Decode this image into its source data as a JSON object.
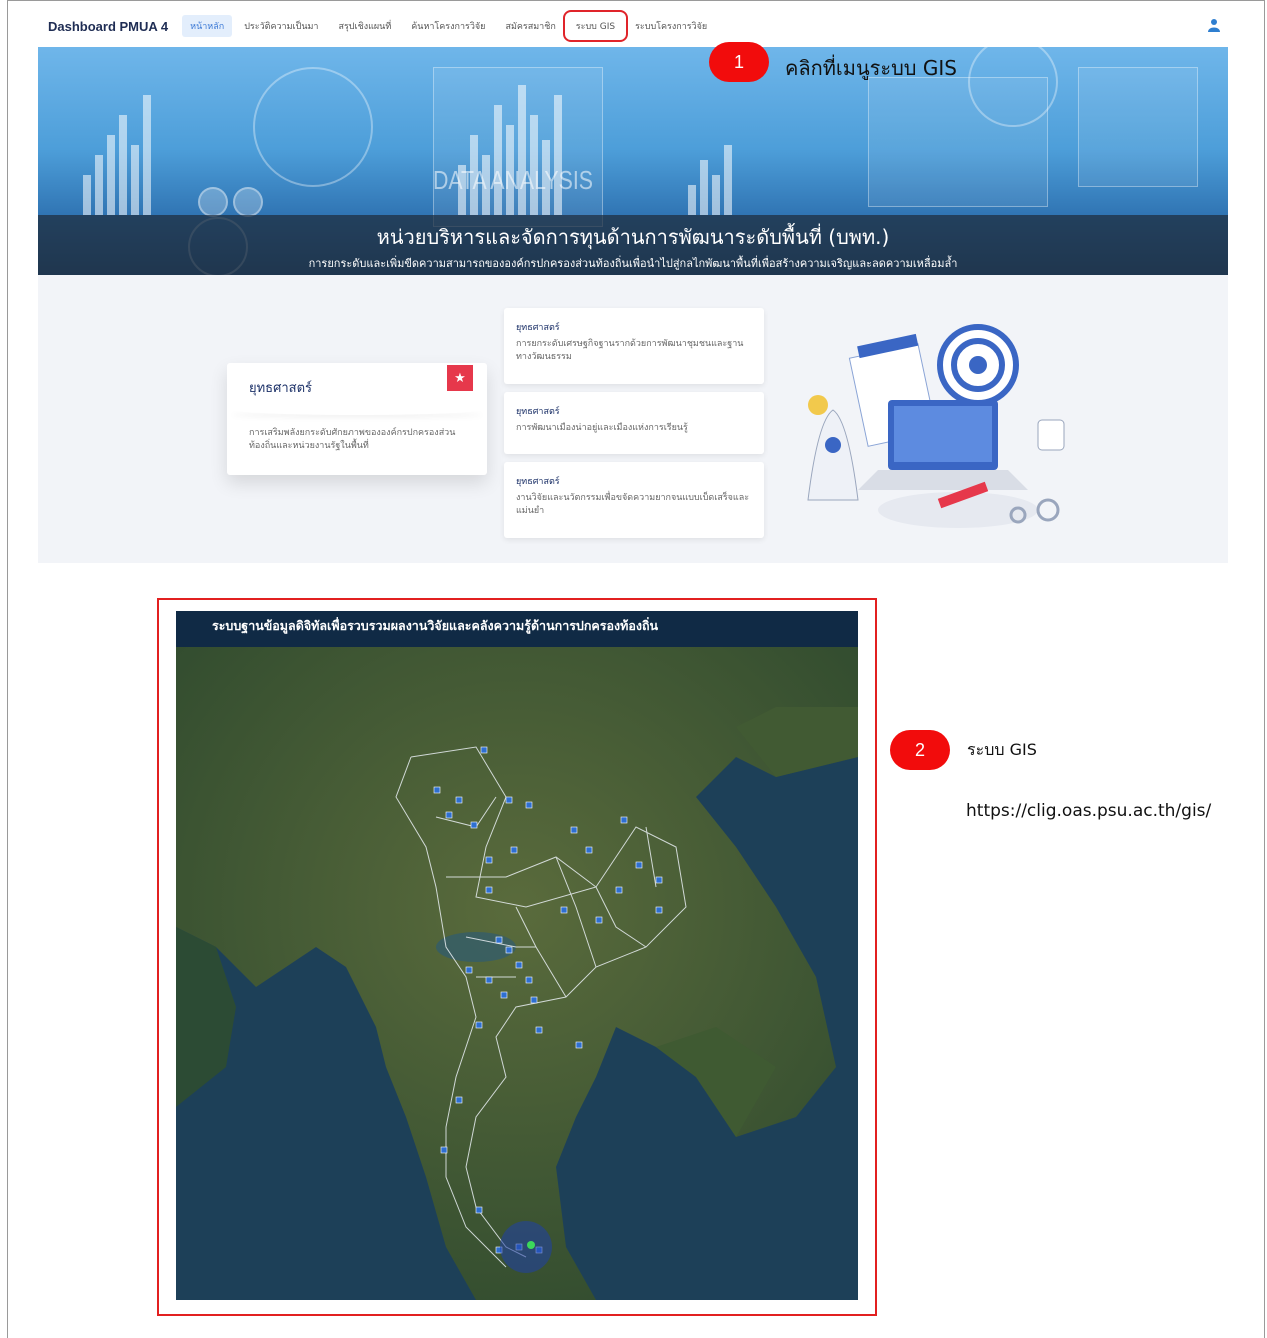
{
  "nav": {
    "brand": "Dashboard PMUA 4",
    "items": [
      {
        "label": "หน้าหลัก",
        "active": true
      },
      {
        "label": "ประวัติความเป็นมา"
      },
      {
        "label": "สรุปเชิงแผนที่"
      },
      {
        "label": "ค้นหาโครงการวิจัย"
      },
      {
        "label": "สมัครสมาชิก"
      },
      {
        "label": "ระบบ GIS",
        "highlighted": true
      },
      {
        "label": "ระบบโครงการวิจัย"
      }
    ],
    "user_icon": "user-icon"
  },
  "hero": {
    "overlay_text": "DATA ANALYSIS",
    "title": "หน่วยบริหารและจัดการทุนด้านการพัฒนาระดับพื้นที่ (บพท.)",
    "subtitle": "การยกระดับและเพิ่มขีดความสามารถขององค์กรปกครองส่วนท้องถิ่นเพื่อนำไปสู่กลไกพัฒนาพื้นที่เพื่อสร้างความเจริญและลดความเหลื่อมล้ำ"
  },
  "steps": {
    "step1": {
      "number": "1",
      "text": "คลิกที่เมนูระบบ GIS"
    },
    "step2": {
      "number": "2",
      "text": "ระบบ GIS",
      "url": "https://clig.oas.psu.ac.th/gis/"
    }
  },
  "strategy": {
    "main": {
      "heading": "ยุทธศาสตร์",
      "body": "การเสริมพลังยกระดับศักยภาพขององค์กรปกครองส่วนท้องถิ่นและหน่วยงานรัฐในพื้นที่"
    },
    "items": [
      {
        "heading": "ยุทธศาสตร์",
        "body": "การยกระดับเศรษฐกิจฐานรากด้วยการพัฒนาชุมชนและฐานทางวัฒนธรรม"
      },
      {
        "heading": "ยุทธศาสตร์",
        "body": "การพัฒนาเมืองน่าอยู่และเมืองแห่งการเรียนรู้"
      },
      {
        "heading": "ยุทธศาสตร์",
        "body": "งานวิจัยและนวัตกรรมเพื่อขจัดความยากจนแบบเบ็ดเสร็จและแม่นยำ"
      }
    ]
  },
  "gis": {
    "header": "ระบบฐานข้อมูลดิจิทัลเพื่อรวบรวมผลงานวิจัยและคลังความรู้ด้านการปกครองท้องถิ่น"
  },
  "colors": {
    "accent": "#3d7ad6",
    "badge": "#f20c0c",
    "highlight_border": "#e22020",
    "gis_header": "#102a45",
    "star": "#e6384b"
  }
}
